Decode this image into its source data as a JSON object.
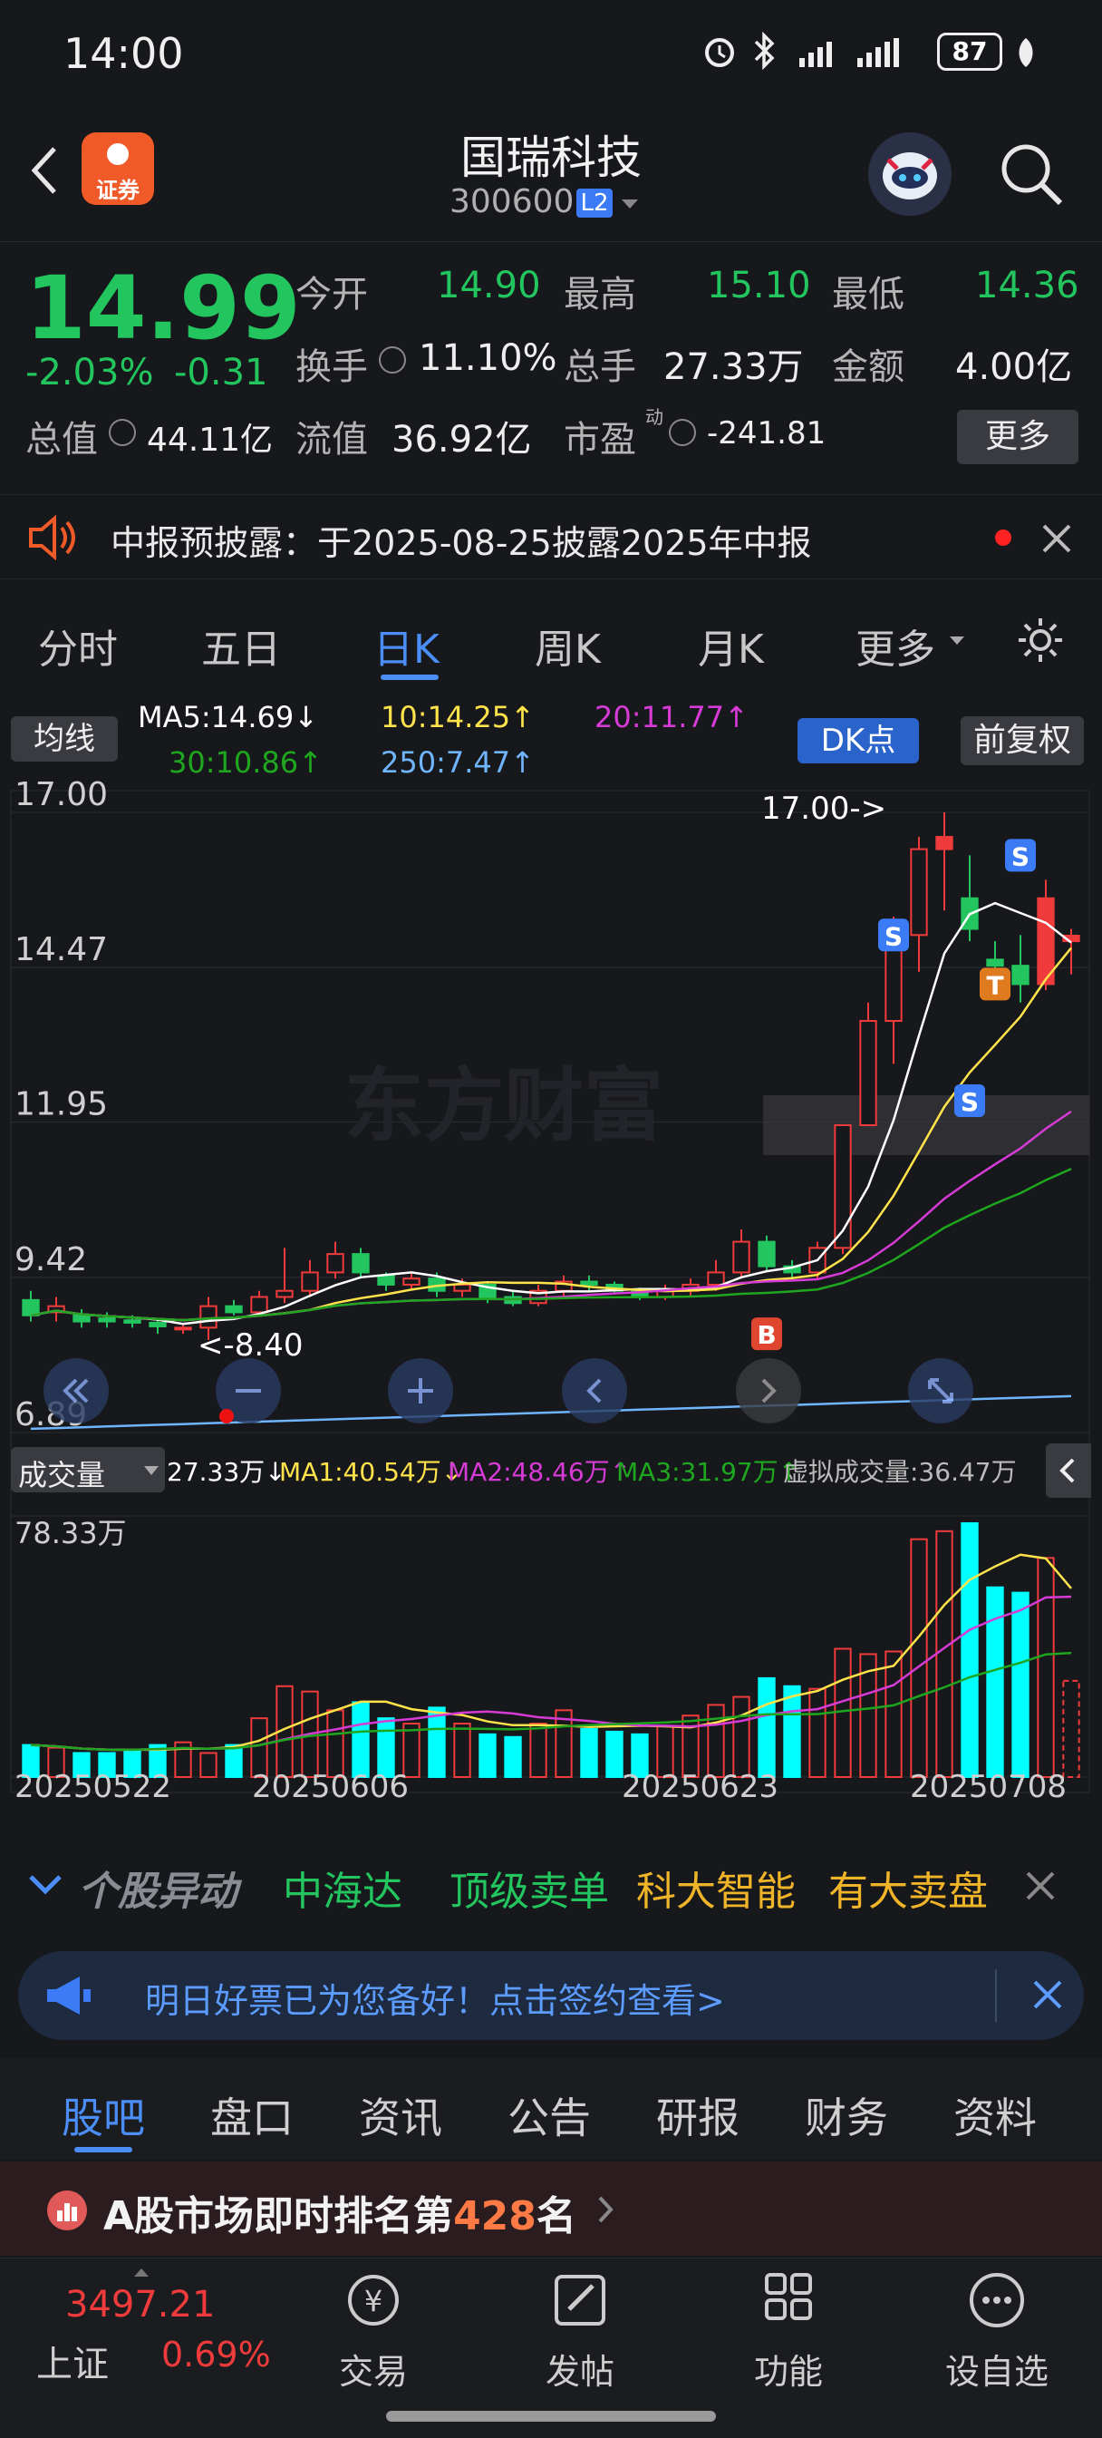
{
  "status_bar": {
    "time": "14:00",
    "battery": "87"
  },
  "header": {
    "title": "国瑞科技",
    "code": "300600",
    "level": "L2",
    "app_icon_text": "证券"
  },
  "quote": {
    "price": "14.99",
    "change_pct": "-2.03%",
    "change_abs": "-0.31",
    "fields": {
      "open_label": "今开",
      "open": "14.90",
      "high_label": "最高",
      "high": "15.10",
      "low_label": "最低",
      "low": "14.36",
      "turnover_label": "换手",
      "turnover": "11.10%",
      "volume_label": "总手",
      "volume": "27.33万",
      "amount_label": "金额",
      "amount": "4.00亿",
      "mktcap_label": "总值",
      "mktcap": "44.11亿",
      "float_label": "流值",
      "float": "36.92亿",
      "pe_label": "市盈",
      "pe_sup": "动",
      "pe": "-241.81",
      "more_label": "更多"
    }
  },
  "notice": {
    "text": "中报预披露：于2025-08-25披露2025年中报"
  },
  "tabs": [
    "分时",
    "五日",
    "日K",
    "周K",
    "月K",
    "更多"
  ],
  "active_tab": "日K",
  "ma_panel": {
    "button": "均线",
    "ma5": "MA5:14.69↓",
    "ma10": "10:14.25↑",
    "ma20": "20:11.77↑",
    "ma30": "30:10.86↑",
    "ma250": "250:7.47↑",
    "dk_button": "DK点",
    "fq_button": "前复权"
  },
  "colors": {
    "up": "#ef3b3b",
    "down": "#22c55e",
    "ma5": "#ffffff",
    "ma10": "#ffe34a",
    "ma20": "#d63bd6",
    "ma30": "#1fa61f",
    "ma250": "#6fb6ff",
    "vol_down": "#00ffff",
    "accent": "#4b8ef7"
  },
  "chart_data": {
    "type": "candlestick",
    "y_ticks": [
      "17.00",
      "14.47",
      "11.95",
      "9.42",
      "6.89"
    ],
    "x_ticks": [
      "20250522",
      "20250606",
      "20250623",
      "20250708"
    ],
    "annotations": {
      "high_label": "17.00->",
      "low_label": "<-8.40",
      "markers": [
        "S",
        "S",
        "S",
        "T",
        "B"
      ]
    },
    "ylim": [
      6.89,
      17.0
    ],
    "candles": [
      {
        "o": 9.05,
        "c": 8.8,
        "h": 9.2,
        "l": 8.7
      },
      {
        "o": 8.85,
        "c": 8.95,
        "h": 9.1,
        "l": 8.7
      },
      {
        "o": 8.8,
        "c": 8.7,
        "h": 8.9,
        "l": 8.6
      },
      {
        "o": 8.75,
        "c": 8.7,
        "h": 8.85,
        "l": 8.6
      },
      {
        "o": 8.72,
        "c": 8.68,
        "h": 8.8,
        "l": 8.6
      },
      {
        "o": 8.68,
        "c": 8.62,
        "h": 8.75,
        "l": 8.5
      },
      {
        "o": 8.6,
        "c": 8.6,
        "h": 8.65,
        "l": 8.5
      },
      {
        "o": 8.6,
        "c": 8.95,
        "h": 9.1,
        "l": 8.4
      },
      {
        "o": 8.95,
        "c": 8.85,
        "h": 9.05,
        "l": 8.8
      },
      {
        "o": 8.85,
        "c": 9.1,
        "h": 9.2,
        "l": 8.8
      },
      {
        "o": 9.1,
        "c": 9.2,
        "h": 9.9,
        "l": 9.0
      },
      {
        "o": 9.2,
        "c": 9.5,
        "h": 9.7,
        "l": 9.1
      },
      {
        "o": 9.5,
        "c": 9.8,
        "h": 10.0,
        "l": 9.4
      },
      {
        "o": 9.8,
        "c": 9.5,
        "h": 9.9,
        "l": 9.4
      },
      {
        "o": 9.45,
        "c": 9.3,
        "h": 9.5,
        "l": 9.2
      },
      {
        "o": 9.3,
        "c": 9.4,
        "h": 9.5,
        "l": 9.2
      },
      {
        "o": 9.4,
        "c": 9.2,
        "h": 9.5,
        "l": 9.1
      },
      {
        "o": 9.2,
        "c": 9.3,
        "h": 9.4,
        "l": 9.1
      },
      {
        "o": 9.3,
        "c": 9.1,
        "h": 9.35,
        "l": 9.0
      },
      {
        "o": 9.1,
        "c": 9.0,
        "h": 9.2,
        "l": 8.95
      },
      {
        "o": 9.0,
        "c": 9.2,
        "h": 9.3,
        "l": 8.95
      },
      {
        "o": 9.2,
        "c": 9.35,
        "h": 9.45,
        "l": 9.1
      },
      {
        "o": 9.35,
        "c": 9.3,
        "h": 9.45,
        "l": 9.2
      },
      {
        "o": 9.3,
        "c": 9.2,
        "h": 9.35,
        "l": 9.15
      },
      {
        "o": 9.2,
        "c": 9.1,
        "h": 9.25,
        "l": 9.05
      },
      {
        "o": 9.1,
        "c": 9.2,
        "h": 9.3,
        "l": 9.05
      },
      {
        "o": 9.2,
        "c": 9.3,
        "h": 9.4,
        "l": 9.1
      },
      {
        "o": 9.3,
        "c": 9.5,
        "h": 9.7,
        "l": 9.2
      },
      {
        "o": 9.5,
        "c": 10.0,
        "h": 10.2,
        "l": 9.4
      },
      {
        "o": 10.0,
        "c": 9.6,
        "h": 10.1,
        "l": 9.5
      },
      {
        "o": 9.6,
        "c": 9.5,
        "h": 9.7,
        "l": 9.4
      },
      {
        "o": 9.5,
        "c": 9.9,
        "h": 10.0,
        "l": 9.4
      },
      {
        "o": 9.9,
        "c": 11.9,
        "h": 11.9,
        "l": 9.8
      },
      {
        "o": 11.9,
        "c": 13.6,
        "h": 13.9,
        "l": 11.9
      },
      {
        "o": 13.6,
        "c": 15.0,
        "h": 15.3,
        "l": 12.9
      },
      {
        "o": 15.0,
        "c": 16.4,
        "h": 16.6,
        "l": 14.4
      },
      {
        "o": 16.4,
        "c": 16.6,
        "h": 17.0,
        "l": 15.4
      },
      {
        "o": 15.6,
        "c": 15.1,
        "h": 16.3,
        "l": 14.9
      },
      {
        "o": 14.6,
        "c": 14.5,
        "h": 14.9,
        "l": 14.2
      },
      {
        "o": 14.5,
        "c": 14.2,
        "h": 15.0,
        "l": 13.9
      },
      {
        "o": 14.2,
        "c": 15.6,
        "h": 15.9,
        "l": 14.1
      },
      {
        "o": 14.9,
        "c": 14.99,
        "h": 15.1,
        "l": 14.36
      }
    ],
    "volume": {
      "ylabel_top": "78.33万",
      "values": [
        12,
        11,
        9,
        9,
        10,
        12,
        13,
        9,
        12,
        22,
        34,
        32,
        25,
        28,
        22,
        20,
        26,
        20,
        16,
        15,
        20,
        25,
        18,
        17,
        16,
        19,
        23,
        27,
        30,
        37,
        34,
        33,
        48,
        46,
        47,
        89,
        92,
        95,
        71,
        69,
        82,
        36
      ]
    }
  },
  "volume_panel": {
    "button": "成交量",
    "vol": "27.33万↓",
    "ma1": "MA1:40.54万↓",
    "ma2": "MA2:48.46万↑",
    "ma3": "MA3:31.97万↑",
    "virtual": "虚拟成交量:36.47万"
  },
  "movement": {
    "title": "个股异动",
    "items": [
      {
        "text": "中海达",
        "color": "#22c55e"
      },
      {
        "text": "顶级卖单",
        "color": "#22c55e"
      },
      {
        "text": "科大智能",
        "color": "#f0b429"
      },
      {
        "text": "有大卖盘",
        "color": "#f0b429"
      }
    ]
  },
  "promo": {
    "text": "明日好票已为您备好！点击签约查看>"
  },
  "sub_tabs": [
    "股吧",
    "盘口",
    "资讯",
    "公告",
    "研报",
    "财务",
    "资料"
  ],
  "active_sub_tab": "股吧",
  "rank": {
    "prefix": "A股市场即时排名第",
    "number": "428",
    "suffix": "名"
  },
  "bottom": {
    "index_value": "3497.21",
    "index_name": "上证",
    "index_change": "0.69%",
    "nav": [
      "交易",
      "发帖",
      "功能",
      "设自选"
    ]
  }
}
